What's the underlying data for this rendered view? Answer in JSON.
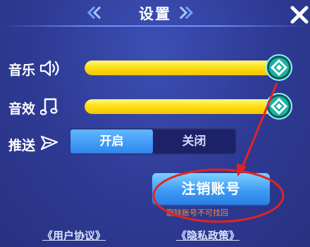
{
  "header": {
    "title": "设置"
  },
  "music": {
    "label": "音乐",
    "icon": "speaker-icon",
    "level": 1.0
  },
  "sfx": {
    "label": "音效",
    "icon": "music-note-icon",
    "level": 1.0
  },
  "push": {
    "label": "推送",
    "icon": "send-icon",
    "on_label": "开启",
    "off_label": "关闭",
    "selected": "开启"
  },
  "account": {
    "cancel_label": "注销账号",
    "warning": "删除账号不可找回"
  },
  "links": {
    "user_agreement": "《用户协议》",
    "privacy_policy": "《隐私政策》"
  },
  "colors": {
    "accent": "#ffe31c",
    "button": "#3d9cf5",
    "warning": "#ff8a2a",
    "annotation": "#e52222"
  }
}
